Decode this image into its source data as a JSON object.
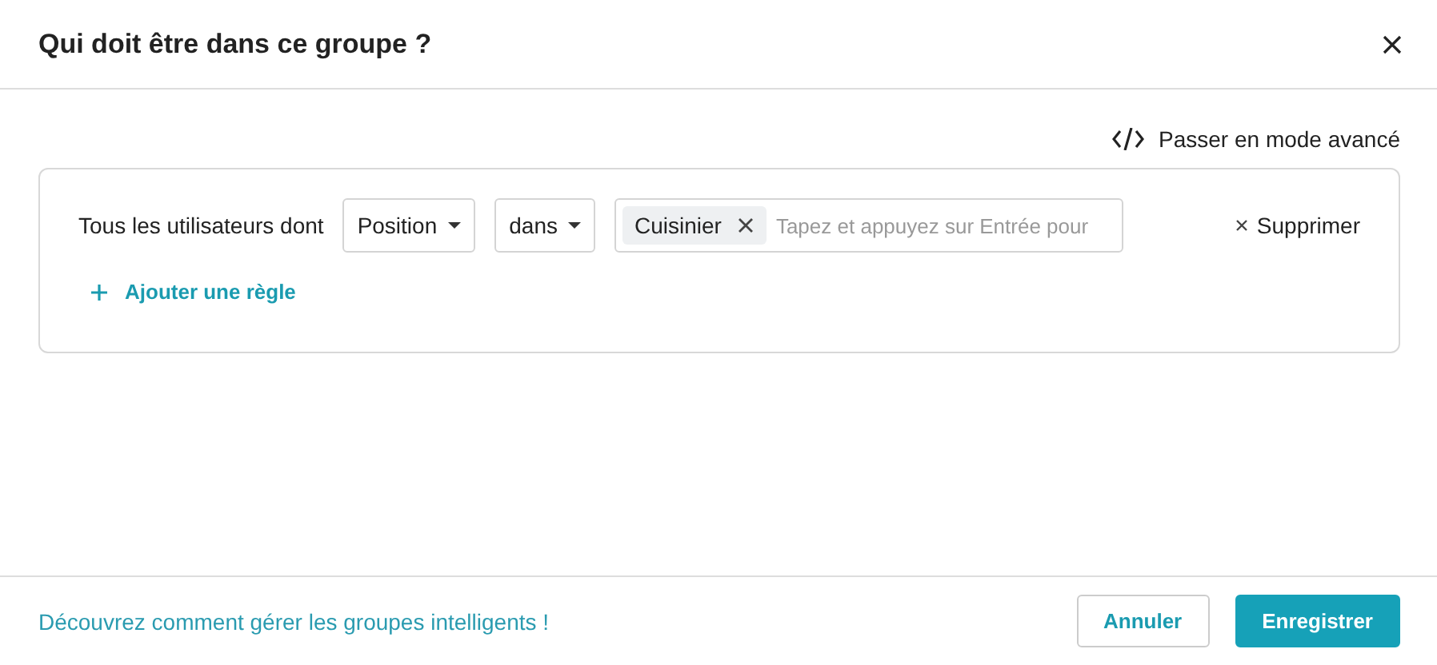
{
  "dialog": {
    "title": "Qui doit être dans ce groupe ?"
  },
  "advanced_link": "Passer en mode avancé",
  "rule": {
    "prefix": "Tous les utilisateurs dont",
    "field": "Position",
    "operator": "dans",
    "tags": [
      "Cuisinier"
    ],
    "placeholder": "Tapez et appuyez sur Entrée pour",
    "remove": "Supprimer"
  },
  "add_rule": "Ajouter une règle",
  "footer": {
    "help_link": "Découvrez comment gérer les groupes intelligents !",
    "buttons": [
      {
        "label": "Annuler",
        "kind": "secondary"
      },
      {
        "label": "Enregistrer",
        "kind": "primary"
      }
    ]
  }
}
